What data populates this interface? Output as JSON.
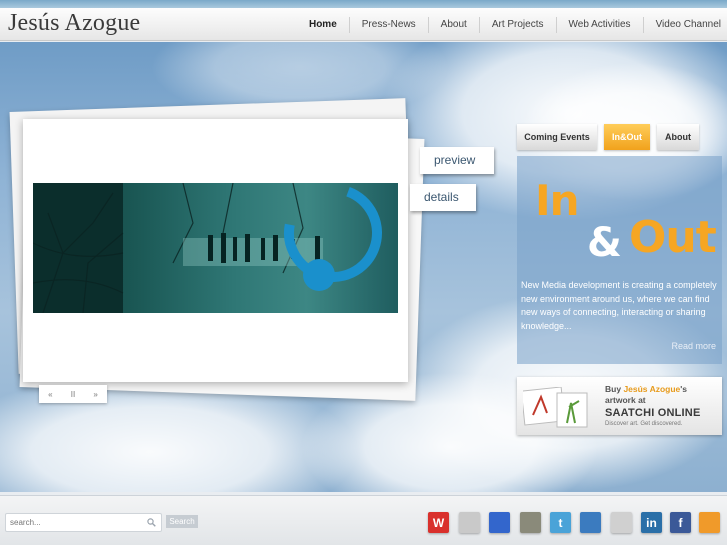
{
  "header": {
    "logo": "Jesús Azogue",
    "nav": [
      "Home",
      "Press-News",
      "About",
      "Art Projects",
      "Web Activities",
      "Video Channel"
    ],
    "active": "Home"
  },
  "slideshow": {
    "preview_label": "preview",
    "details_label": "details",
    "controls": {
      "prev": "«",
      "pause": "II",
      "next": "»"
    }
  },
  "panel": {
    "tabs": [
      "Coming Events",
      "In&Out",
      "About"
    ],
    "active_tab": "In&Out",
    "title_in": "In",
    "title_amp": "&",
    "title_out": "Out",
    "text": "New Media development is creating a completely new environment around us, where we can find new ways of connecting, interacting or sharing knowledge...",
    "read_more": "Read more"
  },
  "banner": {
    "line1_prefix": "Buy",
    "line1_name": "Jesús Azogue",
    "line1_suffix": "'s",
    "line2": "artwork at",
    "brand": "SAATCHI ONLINE",
    "tagline": "Discover art. Get discovered."
  },
  "footer": {
    "search_placeholder": "search...",
    "search_button": "Search",
    "social": [
      {
        "name": "w-icon",
        "glyph": "W",
        "color": "#d9302c"
      },
      {
        "name": "myspace-icon",
        "glyph": "",
        "color": "#c9c9c9"
      },
      {
        "name": "delicious-icon",
        "glyph": "",
        "color": "#3366cc"
      },
      {
        "name": "photo-icon",
        "glyph": "",
        "color": "#8a8a7a"
      },
      {
        "name": "twitter-icon",
        "glyph": "t",
        "color": "#4aa3d8"
      },
      {
        "name": "messenger-icon",
        "glyph": "",
        "color": "#3b7bbf"
      },
      {
        "name": "lastfm-icon",
        "glyph": "",
        "color": "#d0d0d0"
      },
      {
        "name": "linkedin-icon",
        "glyph": "in",
        "color": "#2a6fa8"
      },
      {
        "name": "facebook-icon",
        "glyph": "f",
        "color": "#3b5998"
      },
      {
        "name": "rss-icon",
        "glyph": "",
        "color": "#f09a2a"
      }
    ]
  },
  "colors": {
    "accent": "#f6a623",
    "nav_text": "#444444",
    "sky": "#8fb3d5"
  }
}
